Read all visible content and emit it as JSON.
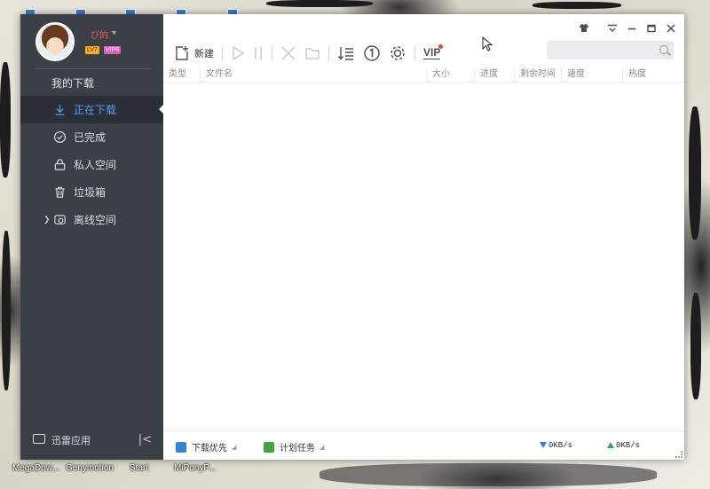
{
  "desktop": {
    "taskbar_labels": [
      "MegaDow...",
      "Genymotion",
      "Start",
      "MiPonyP..."
    ]
  },
  "sidebar": {
    "username": "ぴ的",
    "level_badge": "LV7",
    "vip_badge": "VIP6",
    "section_title": "我的下载",
    "items": [
      {
        "label": "正在下载",
        "icon": "download-arrow-icon",
        "active": true
      },
      {
        "label": "已完成",
        "icon": "check-circle-icon"
      },
      {
        "label": "私人空间",
        "icon": "lock-icon"
      },
      {
        "label": "垃圾箱",
        "icon": "trash-icon"
      },
      {
        "label": "离线空间",
        "icon": "cloud-offline-icon",
        "expandable": true
      }
    ],
    "footer": {
      "apps_label": "迅雷应用"
    }
  },
  "titlebar": {
    "buttons": [
      "skin-icon",
      "menu-icon",
      "minimize-icon",
      "maximize-icon",
      "close-icon"
    ]
  },
  "search": {
    "placeholder": "",
    "value": ""
  },
  "toolbar": {
    "new_label": "新建",
    "vip_label": "VIP",
    "icons": [
      "new-task-icon",
      "start-icon",
      "pause-icon",
      "delete-icon",
      "open-folder-icon",
      "sort-icon",
      "speed-limit-icon",
      "settings-icon",
      "vip-icon"
    ]
  },
  "table": {
    "columns": [
      "类型",
      "文件名",
      "大小",
      "进度",
      "剩余时间",
      "速度",
      "热度"
    ],
    "rows": []
  },
  "statusbar": {
    "priority_label": "下载优先",
    "schedule_label": "计划任务",
    "download_speed": "0KB/s",
    "upload_speed": "0KB/s"
  },
  "colors": {
    "sidebar_bg": "#3b4047",
    "active_item_bg": "#2b2f35",
    "accent_blue": "#4aa0ff",
    "download_arrow": "#2b7fd9",
    "upload_arrow": "#3aa544",
    "priority_icon": "#2f86d8",
    "schedule_icon": "#43a53b"
  }
}
